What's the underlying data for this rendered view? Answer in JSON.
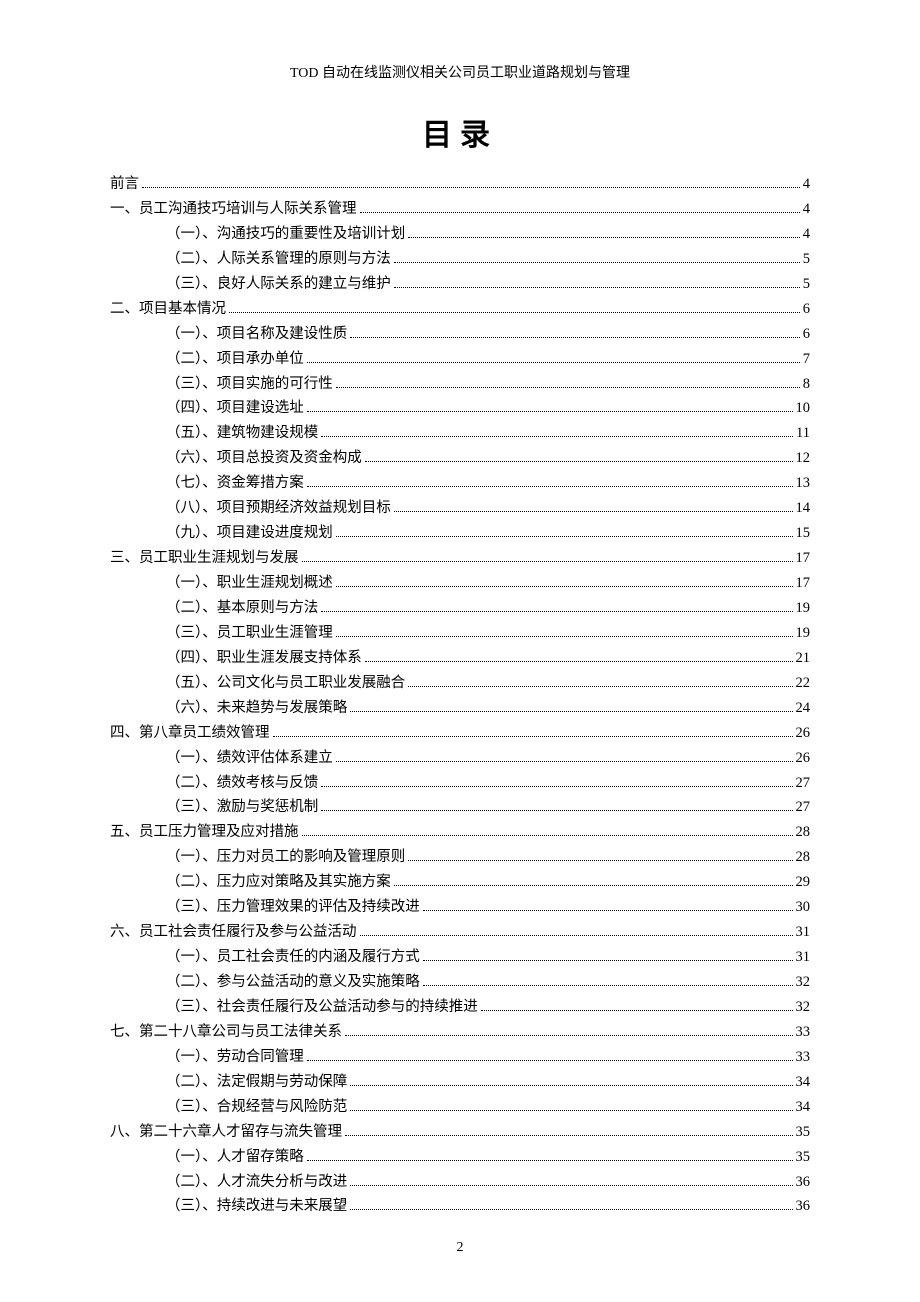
{
  "header": "TOD 自动在线监测仪相关公司员工职业道路规划与管理",
  "toc_title": "目录",
  "page_number": "2",
  "toc": [
    {
      "level": 0,
      "label": "前言",
      "page": "4"
    },
    {
      "level": 0,
      "label": "一、员工沟通技巧培训与人际关系管理",
      "page": "4"
    },
    {
      "level": 1,
      "label": "（一）、沟通技巧的重要性及培训计划",
      "page": "4"
    },
    {
      "level": 1,
      "label": "（二）、人际关系管理的原则与方法",
      "page": "5"
    },
    {
      "level": 1,
      "label": "（三）、良好人际关系的建立与维护",
      "page": "5"
    },
    {
      "level": 0,
      "label": "二、项目基本情况",
      "page": "6"
    },
    {
      "level": 1,
      "label": "（一）、项目名称及建设性质",
      "page": "6"
    },
    {
      "level": 1,
      "label": "（二）、项目承办单位",
      "page": "7"
    },
    {
      "level": 1,
      "label": "（三）、项目实施的可行性",
      "page": "8"
    },
    {
      "level": 1,
      "label": "（四）、项目建设选址",
      "page": "10"
    },
    {
      "level": 1,
      "label": "（五）、建筑物建设规模",
      "page": "11"
    },
    {
      "level": 1,
      "label": "（六）、项目总投资及资金构成",
      "page": "12"
    },
    {
      "level": 1,
      "label": "（七）、资金筹措方案",
      "page": "13"
    },
    {
      "level": 1,
      "label": "（八）、项目预期经济效益规划目标",
      "page": "14"
    },
    {
      "level": 1,
      "label": "（九）、项目建设进度规划",
      "page": "15"
    },
    {
      "level": 0,
      "label": "三、员工职业生涯规划与发展",
      "page": "17"
    },
    {
      "level": 1,
      "label": "（一）、职业生涯规划概述",
      "page": "17"
    },
    {
      "level": 1,
      "label": "（二）、基本原则与方法",
      "page": "19"
    },
    {
      "level": 1,
      "label": "（三）、员工职业生涯管理",
      "page": "19"
    },
    {
      "level": 1,
      "label": "（四）、职业生涯发展支持体系",
      "page": "21"
    },
    {
      "level": 1,
      "label": "（五）、公司文化与员工职业发展融合",
      "page": "22"
    },
    {
      "level": 1,
      "label": "（六）、未来趋势与发展策略",
      "page": "24"
    },
    {
      "level": 0,
      "label": "四、第八章员工绩效管理",
      "page": "26"
    },
    {
      "level": 1,
      "label": "（一）、绩效评估体系建立",
      "page": "26"
    },
    {
      "level": 1,
      "label": "（二）、绩效考核与反馈",
      "page": "27"
    },
    {
      "level": 1,
      "label": "（三）、激励与奖惩机制",
      "page": "27"
    },
    {
      "level": 0,
      "label": "五、员工压力管理及应对措施",
      "page": "28"
    },
    {
      "level": 1,
      "label": "（一）、压力对员工的影响及管理原则",
      "page": "28"
    },
    {
      "level": 1,
      "label": "（二）、压力应对策略及其实施方案",
      "page": "29"
    },
    {
      "level": 1,
      "label": "（三）、压力管理效果的评估及持续改进",
      "page": "30"
    },
    {
      "level": 0,
      "label": "六、员工社会责任履行及参与公益活动",
      "page": "31"
    },
    {
      "level": 1,
      "label": "（一）、员工社会责任的内涵及履行方式",
      "page": "31"
    },
    {
      "level": 1,
      "label": "（二）、参与公益活动的意义及实施策略",
      "page": "32"
    },
    {
      "level": 1,
      "label": "（三）、社会责任履行及公益活动参与的持续推进",
      "page": "32"
    },
    {
      "level": 0,
      "label": "七、第二十八章公司与员工法律关系",
      "page": "33"
    },
    {
      "level": 1,
      "label": "（一）、劳动合同管理",
      "page": "33"
    },
    {
      "level": 1,
      "label": "（二）、法定假期与劳动保障",
      "page": "34"
    },
    {
      "level": 1,
      "label": "（三）、合规经营与风险防范",
      "page": "34"
    },
    {
      "level": 0,
      "label": "八、第二十六章人才留存与流失管理",
      "page": "35"
    },
    {
      "level": 1,
      "label": "（一）、人才留存策略",
      "page": "35"
    },
    {
      "level": 1,
      "label": "（二）、人才流失分析与改进",
      "page": "36"
    },
    {
      "level": 1,
      "label": "（三）、持续改进与未来展望",
      "page": "36"
    }
  ]
}
